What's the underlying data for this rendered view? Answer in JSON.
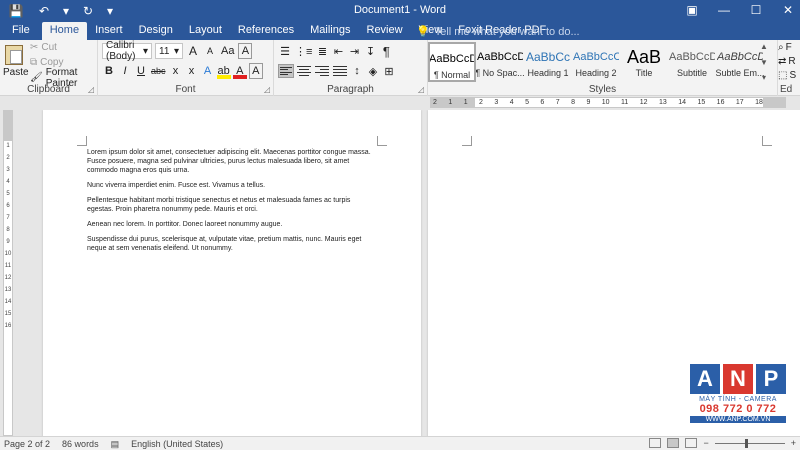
{
  "titlebar": {
    "title": "Document1 - Word",
    "qat": [
      {
        "icon": "save-icon",
        "glyph": "💾"
      },
      {
        "icon": "undo-icon",
        "glyph": "↶"
      },
      {
        "icon": "undo-dropdown-icon",
        "glyph": "▾"
      },
      {
        "icon": "redo-icon",
        "glyph": "↻"
      },
      {
        "icon": "customize-qat-icon",
        "glyph": "▾"
      }
    ],
    "window_controls": [
      {
        "icon": "ribbon-display-options-icon",
        "glyph": "▣"
      },
      {
        "icon": "minimize-icon",
        "glyph": "—"
      },
      {
        "icon": "maximize-icon",
        "glyph": "☐"
      },
      {
        "icon": "close-icon",
        "glyph": "✕"
      }
    ]
  },
  "tabs": [
    "File",
    "Home",
    "Insert",
    "Design",
    "Layout",
    "References",
    "Mailings",
    "Review",
    "View",
    "Foxit Reader PDF"
  ],
  "active_tab": "Home",
  "tell_me": {
    "icon": "lightbulb-icon",
    "glyph": "💡",
    "placeholder": "Tell me what you want to do..."
  },
  "clipboard": {
    "label": "Clipboard",
    "paste": "Paste",
    "cut": "Cut",
    "copy": "Copy",
    "format_painter": "Format Painter"
  },
  "font": {
    "label": "Font",
    "name": "Calibri (Body)",
    "size": "11",
    "grow": "A",
    "shrink": "A",
    "case": "Aa",
    "clear": "A",
    "bold": "B",
    "italic": "I",
    "underline": "U",
    "strike": "abc",
    "subscript": "x",
    "superscript": "x",
    "effects": "A",
    "highlight": "ab",
    "color": "A",
    "shading": "A"
  },
  "paragraph": {
    "label": "Paragraph",
    "pilcrow": "¶"
  },
  "styles": {
    "label": "Styles",
    "items": [
      {
        "preview": "AaBbCcDc",
        "name": "¶ Normal",
        "selected": true
      },
      {
        "preview": "AaBbCcDc",
        "name": "¶ No Spac..."
      },
      {
        "preview": "AaBbCc",
        "name": "Heading 1"
      },
      {
        "preview": "AaBbCcC",
        "name": "Heading 2"
      },
      {
        "preview": "AaB",
        "name": "Title"
      },
      {
        "preview": "AaBbCcD",
        "name": "Subtitle"
      },
      {
        "preview": "AaBbCcDa",
        "name": "Subtle Em..."
      }
    ]
  },
  "editing": {
    "label": "Ed",
    "items": [
      "F",
      "R",
      "S"
    ]
  },
  "ruler": {
    "h_numbers": [
      "2",
      "1",
      "1",
      "2",
      "3",
      "4",
      "5",
      "6",
      "7",
      "8",
      "9",
      "10",
      "11",
      "12",
      "13",
      "14",
      "15",
      "16",
      "17",
      "18"
    ],
    "v_numbers": [
      "1",
      "2",
      "3",
      "4",
      "5",
      "6",
      "7",
      "8",
      "9",
      "10",
      "11",
      "12",
      "13",
      "14",
      "15",
      "16"
    ]
  },
  "document": {
    "paragraphs": [
      "Lorem ipsum dolor sit amet, consectetuer adipiscing elit. Maecenas porttitor congue massa. Fusce posuere, magna sed pulvinar ultricies, purus lectus malesuada libero, sit amet commodo magna eros quis urna.",
      "Nunc viverra imperdiet enim. Fusce est. Vivamus a tellus.",
      "Pellentesque habitant morbi tristique senectus et netus et malesuada fames ac turpis egestas. Proin pharetra nonummy pede. Mauris et orci.",
      "Aenean nec lorem. In porttitor. Donec laoreet nonummy augue.",
      "Suspendisse dui purus, scelerisque at, vulputate vitae, pretium mattis, nunc. Mauris eget neque at sem venenatis eleifend. Ut nonummy."
    ]
  },
  "status": {
    "page": "Page 2 of 2",
    "words": "86 words",
    "language": "English (United States)"
  },
  "watermark": {
    "letters": [
      "A",
      "N",
      "P"
    ],
    "letter_colors": [
      "#2b5fa8",
      "#d9382f",
      "#2b5fa8"
    ],
    "subtitle": "MÁY TÍNH - CAMERA",
    "phone": "098 772 0 772",
    "site": "WWW.ANP.COM.VN"
  },
  "colors": {
    "word_blue": "#2b579a",
    "ribbon_bg": "#f3f3f3",
    "canvas_bg": "#e6e6e6"
  }
}
